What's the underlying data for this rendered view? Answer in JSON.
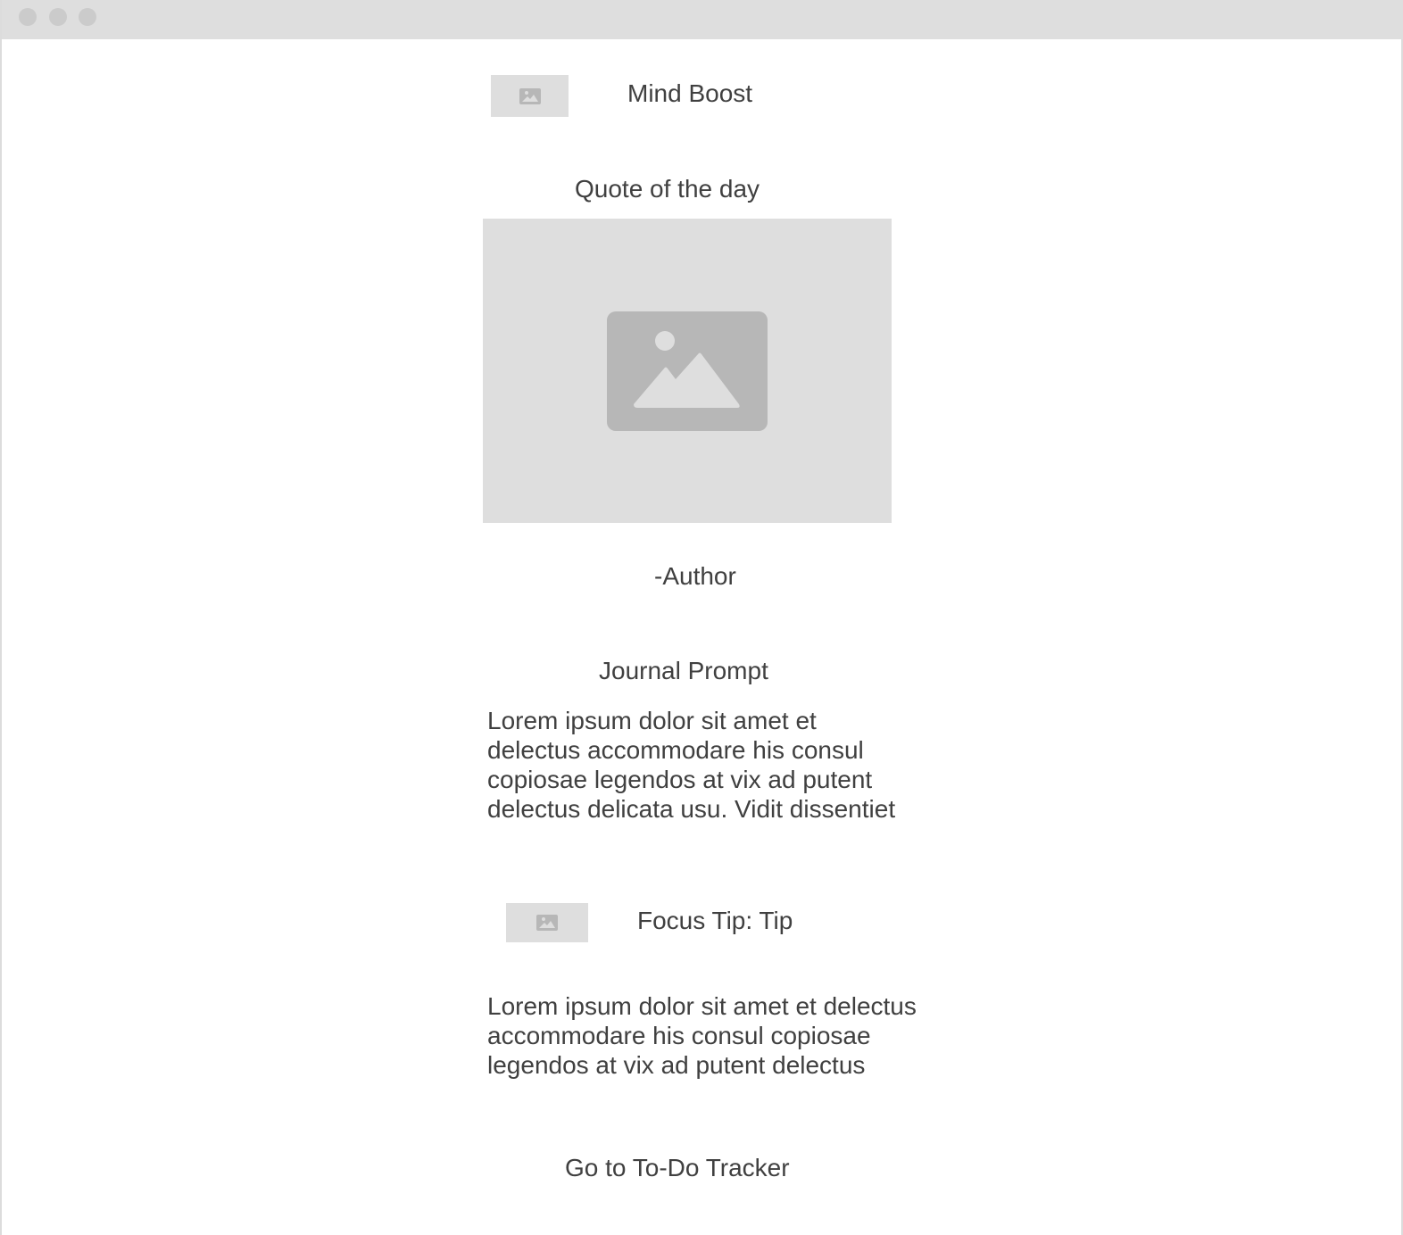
{
  "window": {
    "controls": [
      "close-dot",
      "minimize-dot",
      "maximize-dot"
    ]
  },
  "header": {
    "logo_icon": "image-placeholder-icon",
    "title": "Mind Boost"
  },
  "quote": {
    "heading": "Quote of the day",
    "image_icon": "image-placeholder-icon",
    "author": "-Author"
  },
  "journal": {
    "heading": "Journal Prompt",
    "lines": [
      "Lorem ipsum dolor sit amet et",
      "delectus accommodare his consul",
      "copiosae legendos at vix ad putent",
      "delectus delicata usu. Vidit dissentiet"
    ]
  },
  "focus_tip": {
    "image_icon": "image-placeholder-icon",
    "title": "Focus Tip: Tip",
    "lines": [
      "Lorem ipsum dolor sit amet et delectus",
      "accommodare his consul copiosae",
      "legendos at vix ad putent delectus"
    ]
  },
  "footer": {
    "todo_link": "Go to To-Do Tracker"
  },
  "colors": {
    "placeholder_bg": "#dedede",
    "placeholder_icon": "#b7b7b7",
    "text": "#404040",
    "titlebar": "#dedede"
  }
}
